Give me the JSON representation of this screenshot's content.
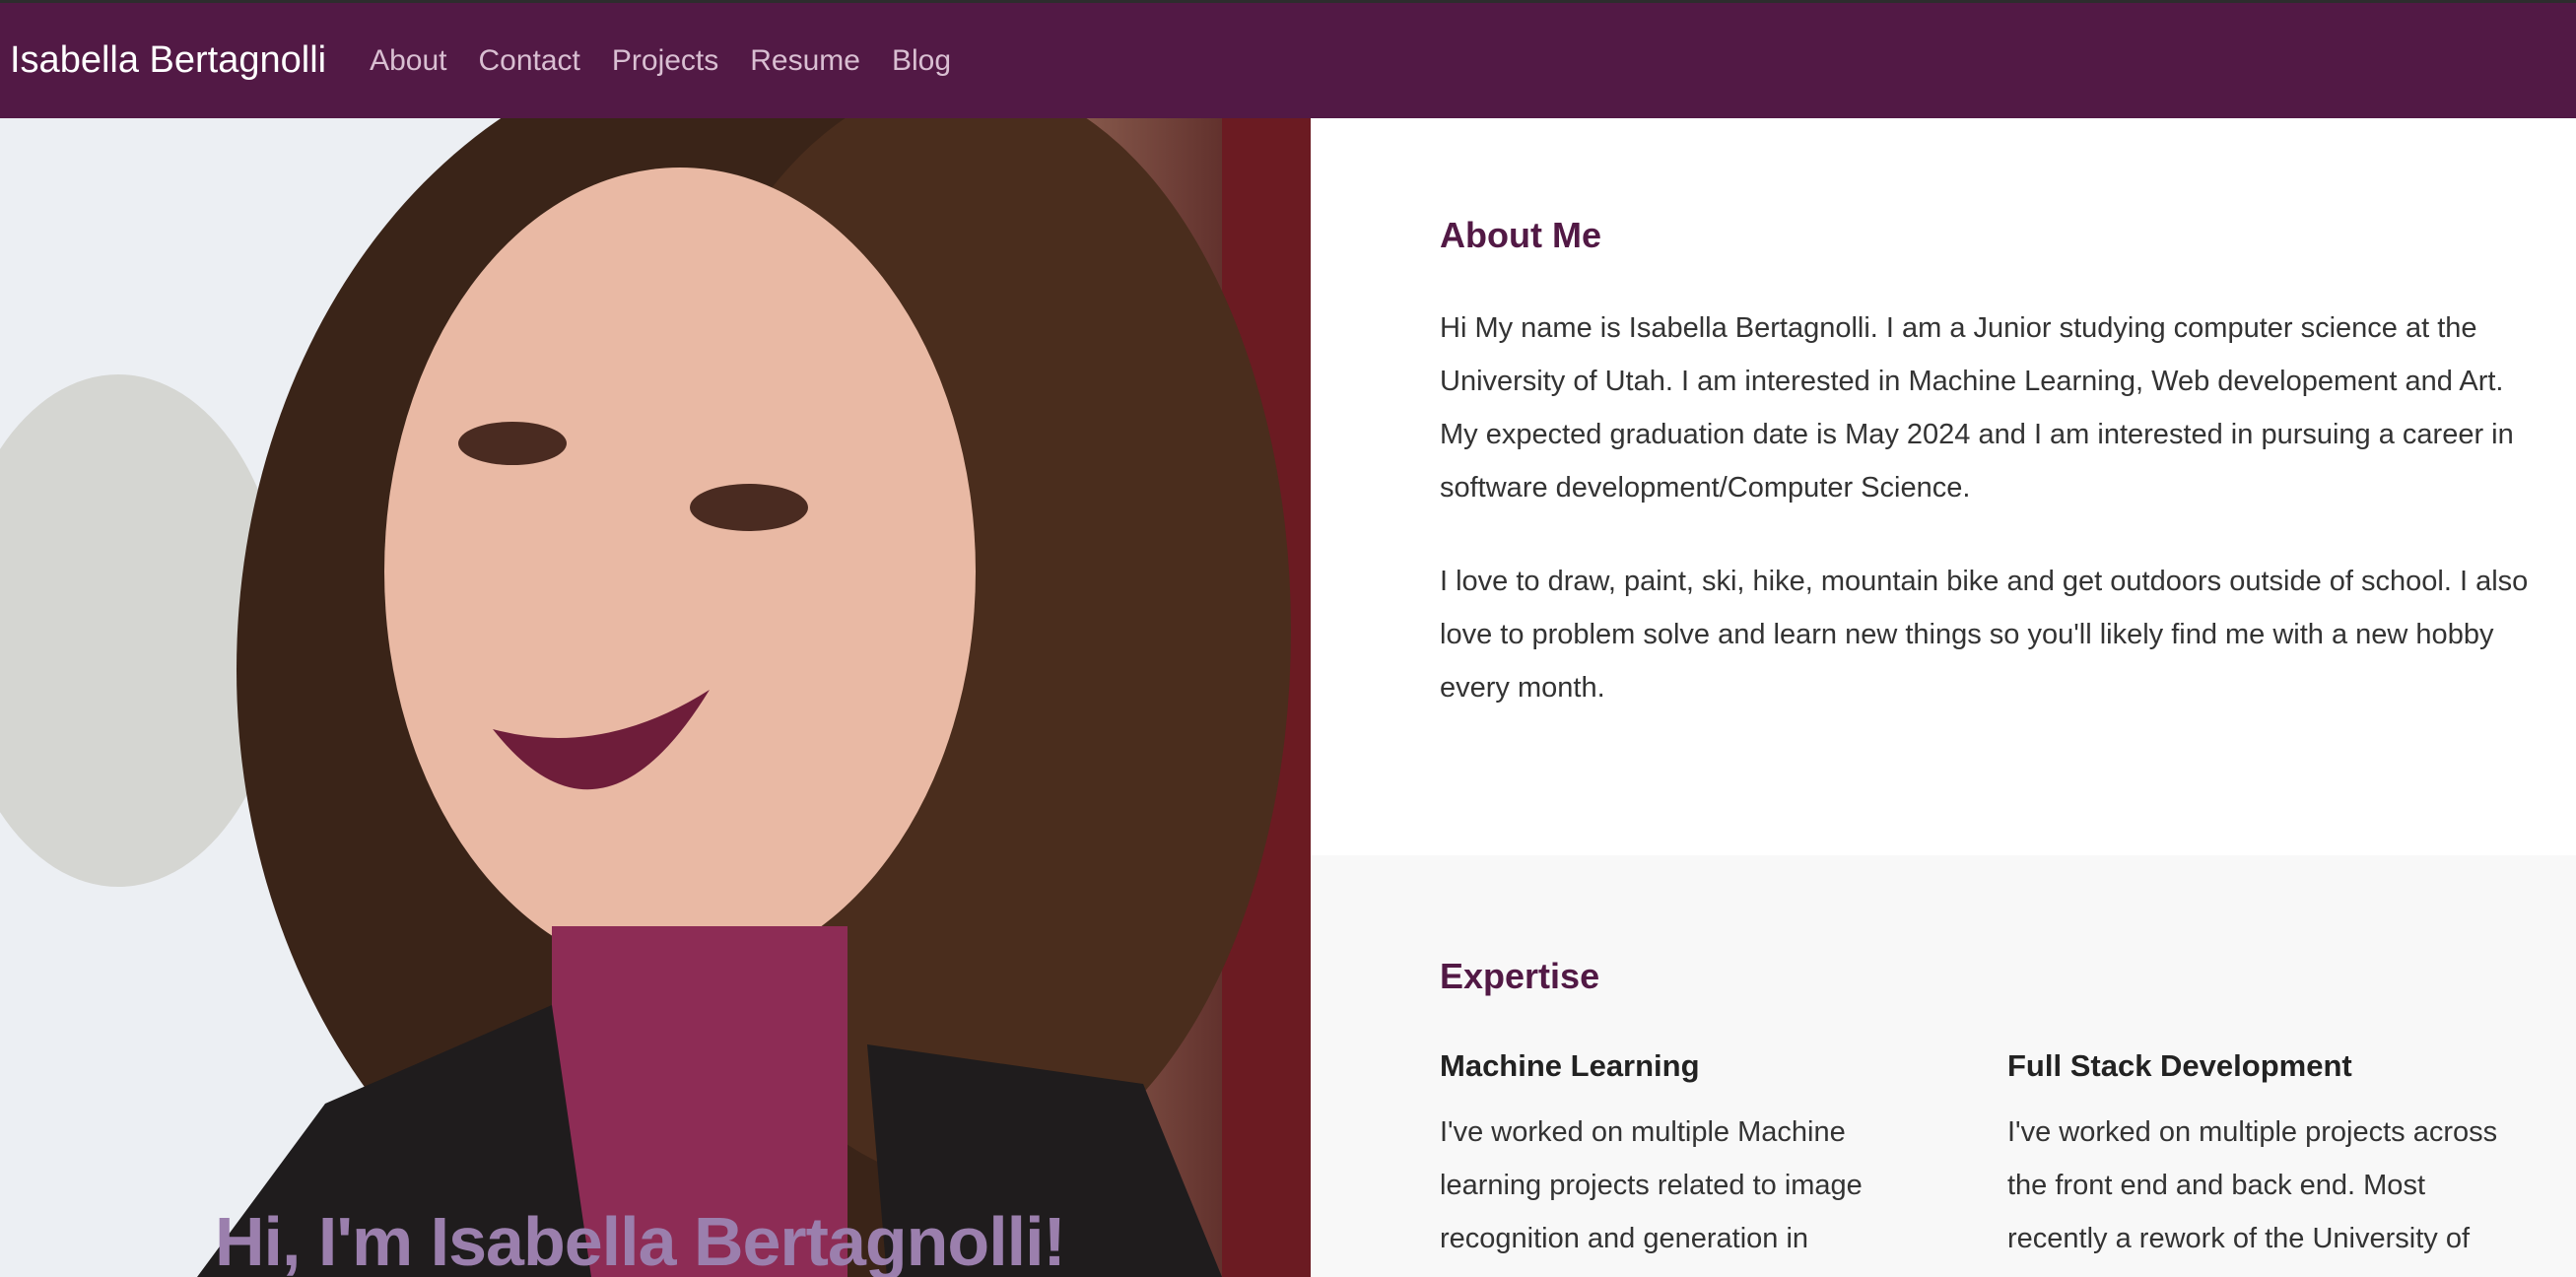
{
  "navbar": {
    "brand": "Isabella Bertagnolli",
    "links": [
      "About",
      "Contact",
      "Projects",
      "Resume",
      "Blog"
    ]
  },
  "hero": {
    "title": "Hi, I'm Isabella Bertagnolli!"
  },
  "about": {
    "heading": "About Me",
    "paragraphs": [
      "Hi My name is Isabella Bertagnolli. I am a Junior studying computer science at the University of Utah. I am interested in Machine Learning, Web developement and Art. My expected graduation date is May 2024 and I am interested in pursuing a career in software development/Computer Science.",
      "I love to draw, paint, ski, hike, mountain bike and get outdoors outside of school. I also love to problem solve and learn new things so you'll likely find me with a new hobby every month."
    ]
  },
  "expertise": {
    "heading": "Expertise",
    "items": [
      {
        "title": "Machine Learning",
        "text": "I've worked on multiple Machine learning projects related to image recognition and generation in"
      },
      {
        "title": "Full Stack Development",
        "text": "I've worked on multiple projects across the front end and back end. Most recently a rework of the University of"
      }
    ]
  },
  "colors": {
    "brand": "#521945",
    "nav_link": "#d9bfd2",
    "heading": "#521945",
    "hero_title": "#9b7fad",
    "alt_section_bg": "#f8f8f8"
  }
}
